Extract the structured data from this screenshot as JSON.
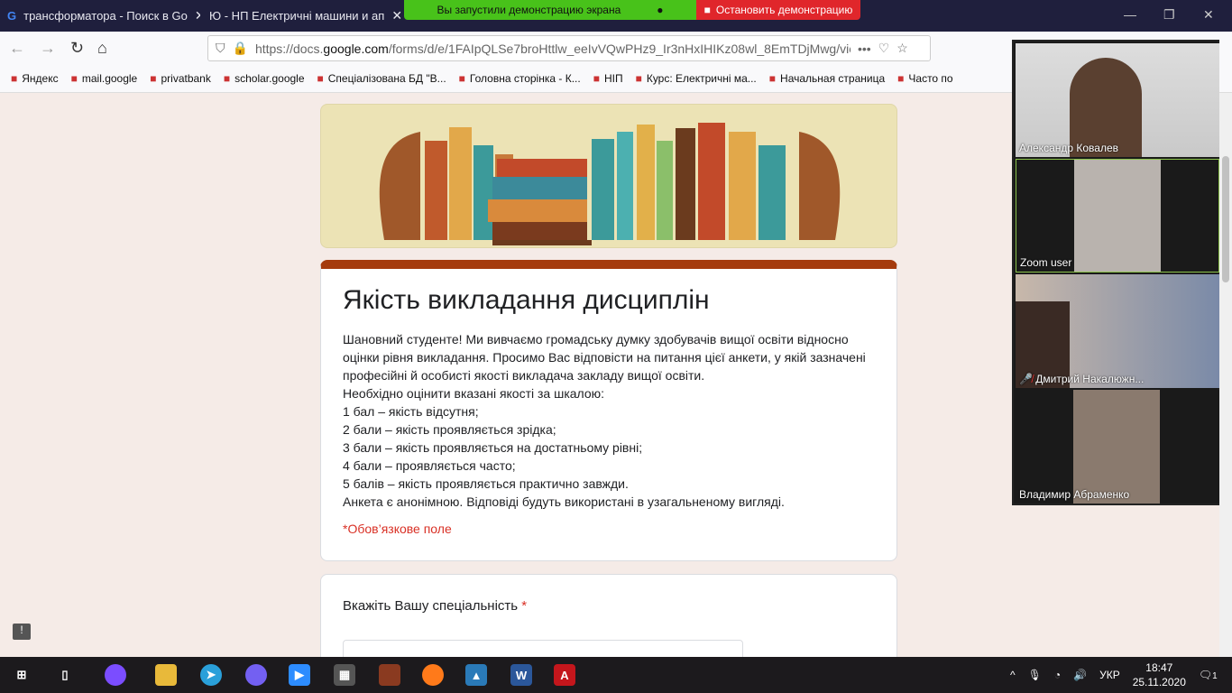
{
  "browser": {
    "tabs": [
      {
        "label": "трансформатора - Поиск в Go"
      },
      {
        "label": "Ю - НП Електричні машини и ап"
      }
    ],
    "url_prefix": "https://docs.",
    "url_host": "google.com",
    "url_rest": "/forms/d/e/1FAIpQLSe7broHttlw_eeIvVQwPHz9_Ir3nHxIHIKz08wl_8EmTDjMwg/vie",
    "bookmarks": [
      {
        "label": "Яндекс",
        "icon": "yandex-icon"
      },
      {
        "label": "mail.google",
        "icon": "gmail-icon"
      },
      {
        "label": "privatbank",
        "icon": "privatbank-icon"
      },
      {
        "label": "scholar.google",
        "icon": "scholar-icon"
      },
      {
        "label": "Спеціалізована БД \"В...",
        "icon": "page-icon"
      },
      {
        "label": "Головна сторінка - К...",
        "icon": "crest-icon"
      },
      {
        "label": "НІП",
        "icon": "nip-icon"
      },
      {
        "label": "Курс: Електричні ма...",
        "icon": "moodle-icon"
      },
      {
        "label": "Начальная страница",
        "icon": "globe-icon"
      },
      {
        "label": "Часто по",
        "icon": "gear-icon"
      }
    ]
  },
  "screenshare": {
    "banner": "Вы запустили демонстрацию экрана",
    "stop": "Остановить демонстрацию"
  },
  "form": {
    "title": "Якість викладання дисциплін",
    "description": [
      "Шановний студенте! Ми вивчаємо громадську думку  здобувачів вищої освіти відносно оцінки рівня викладання. Просимо Вас відповісти на питання цієї анкети, у якій зазначені професійні й особисті якості викладача закладу вищої освіти.",
      "Необхідно оцінити вказані якості за шкалою:",
      "1 бал – якість відсутня;",
      "2 бали – якість проявляється зрідка;",
      "3 бали – якість проявляється на достатньому рівні;",
      "4 бали – проявляється часто;",
      "5 балів – якість проявляється практично завжди.",
      "Анкета є анонімною. Відповіді будуть використані в узагальненому вигляді."
    ],
    "required_note": "*Обов’язкове поле",
    "question": "Вкажіть Вашу спеціальність",
    "question_star": "*"
  },
  "zoom": {
    "participants": [
      {
        "name": "Александр Ковалев"
      },
      {
        "name": "Zoom user"
      },
      {
        "name": "Дмитрий Накалюжн..."
      },
      {
        "name": "Владимир Абраменко"
      }
    ]
  },
  "tray": {
    "lang": "УКР",
    "time": "18:47",
    "date": "25.11.2020",
    "notifications": "1"
  },
  "colors": {
    "accent": "#a53b0d",
    "required": "#d93025",
    "share_green": "#48c21a",
    "stop_red": "#e0262b"
  }
}
